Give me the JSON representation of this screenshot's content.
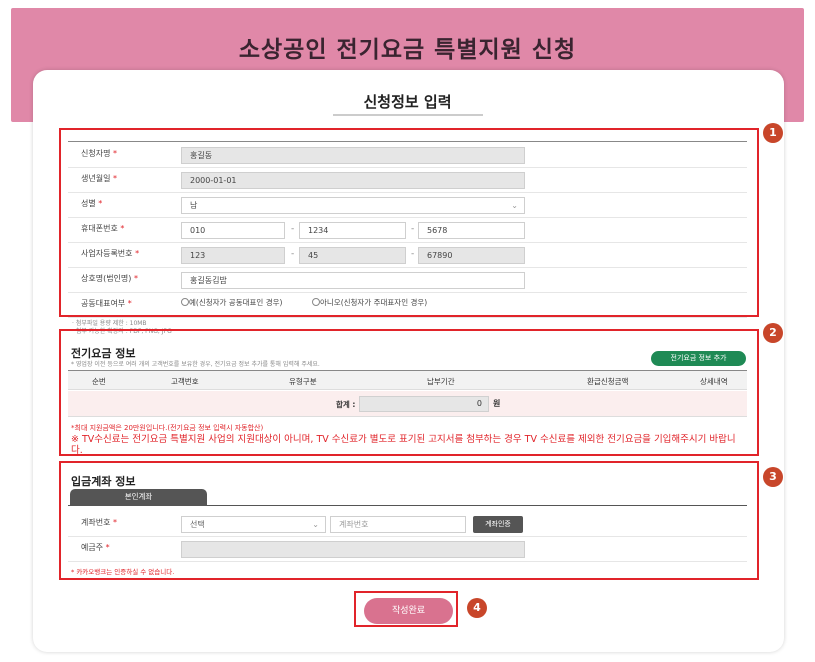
{
  "page_title": "소상공인 전기요금 특별지원 신청",
  "subtitle": "신청정보 입력",
  "badges": [
    "1",
    "2",
    "3",
    "4"
  ],
  "applicant": {
    "name_label": "신청자명",
    "name_value": "홍길동",
    "birth_label": "생년월일",
    "birth_value": "2000-01-01",
    "gender_label": "성별",
    "gender_value": "남",
    "phone_label": "휴대폰번호",
    "phone": [
      "010",
      "1234",
      "5678"
    ],
    "bizno_label": "사업자등록번호",
    "bizno": [
      "123",
      "45",
      "67890"
    ],
    "company_label": "상호명(법인명)",
    "company_value": "홍길동김밥",
    "corep_label": "공동대표여부",
    "corep_yes": "예(신청자가 공동대표인 경우)",
    "corep_no": "아니오(신청자가 주대표자인 경우)",
    "required_mark": "*",
    "dash": "-"
  },
  "attach_notes": [
    "· 첨부파일 용량 제한 : 10MB",
    "· 첨부 가능한 확장자 : PDF, PNG, JPG"
  ],
  "electric": {
    "title": "전기요금 정보",
    "sub": "* 영업장 이전 등으로 여러 개의 고객번호를 보유한 경우, 전기요금 정보 추가를 통해 입력해 주세요.",
    "add_button": "전기요금 정보 추가",
    "columns": [
      "순번",
      "고객번호",
      "유형구분",
      "납부기간",
      "환급신청금액",
      "상세내역"
    ],
    "total_label": "합계 :",
    "total_value": "0",
    "total_unit": "원",
    "note_small": "*최대 지원금액은 20만원입니다.(전기요금 정보 입력시 자동합산)",
    "note_large": "※ TV수신료는 전기요금 특별지원 사업의 지원대상이 아니며, TV 수신료가 별도로 표기된 고지서를 첨부하는 경우 TV 수신료를 제외한 전기요금을 기입해주시기 바랍니다."
  },
  "account": {
    "title": "입금계좌 정보",
    "tab": "본인계좌",
    "account_label": "계좌번호",
    "bank_select": "선택",
    "account_placeholder": "계좌번호",
    "verify_button": "계좌인증",
    "holder_label": "예금주",
    "note": "* 카카오뱅크는 인증하실 수 없습니다."
  },
  "submit_button": "작성완료",
  "colors": {
    "header_pink": "#e088a8",
    "highlight_red": "#e1242a",
    "badge": "#c8462a",
    "green_button": "#1f8a55",
    "submit_pink": "#d9728f"
  }
}
